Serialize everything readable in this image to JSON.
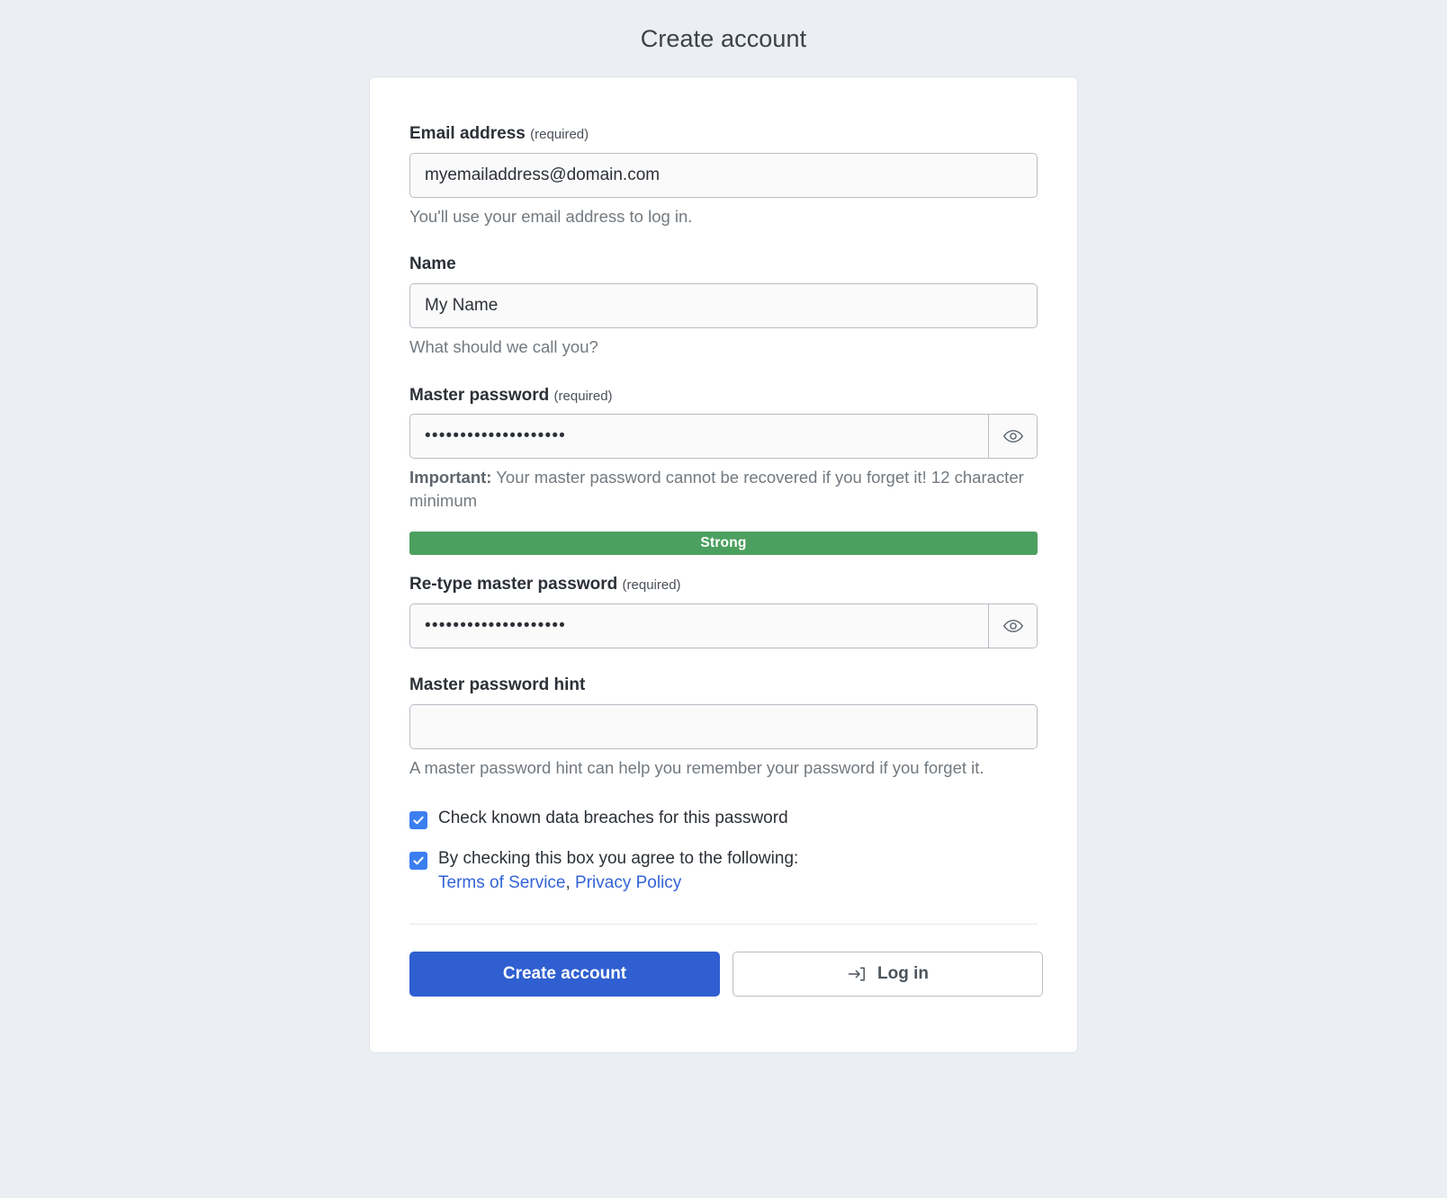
{
  "page": {
    "title": "Create account"
  },
  "form": {
    "email": {
      "label": "Email address",
      "required_tag": "(required)",
      "value": "myemailaddress@domain.com",
      "placeholder": "",
      "help": "You'll use your email address to log in."
    },
    "name": {
      "label": "Name",
      "value": "My Name",
      "placeholder": "",
      "help": "What should we call you?"
    },
    "master_password": {
      "label": "Master password",
      "required_tag": "(required)",
      "value": "••••••••••••••••••••",
      "help_strong": "Important:",
      "help": " Your master password cannot be recovered if you forget it! 12 character minimum",
      "toggle_icon": "eye-icon",
      "strength_label": "Strong",
      "strength_color": "#4ca05f"
    },
    "retype_password": {
      "label": "Re-type master password",
      "required_tag": "(required)",
      "value": "••••••••••••••••••••",
      "toggle_icon": "eye-icon"
    },
    "password_hint": {
      "label": "Master password hint",
      "value": "",
      "placeholder": "",
      "help": "A master password hint can help you remember your password if you forget it."
    },
    "checkboxes": [
      {
        "label": "Check known data breaches for this password",
        "checked": true
      },
      {
        "label": "By checking this box you agree to the following:",
        "checked": true
      }
    ],
    "terms": {
      "terms_label": "Terms of Service",
      "separator": ", ",
      "privacy_label": "Privacy Policy"
    }
  },
  "actions": {
    "create_label": "Create account",
    "login_label": "Log in",
    "login_icon": "sign-in-icon",
    "primary_color": "#2f5fd0",
    "link_color": "#3363d6"
  }
}
